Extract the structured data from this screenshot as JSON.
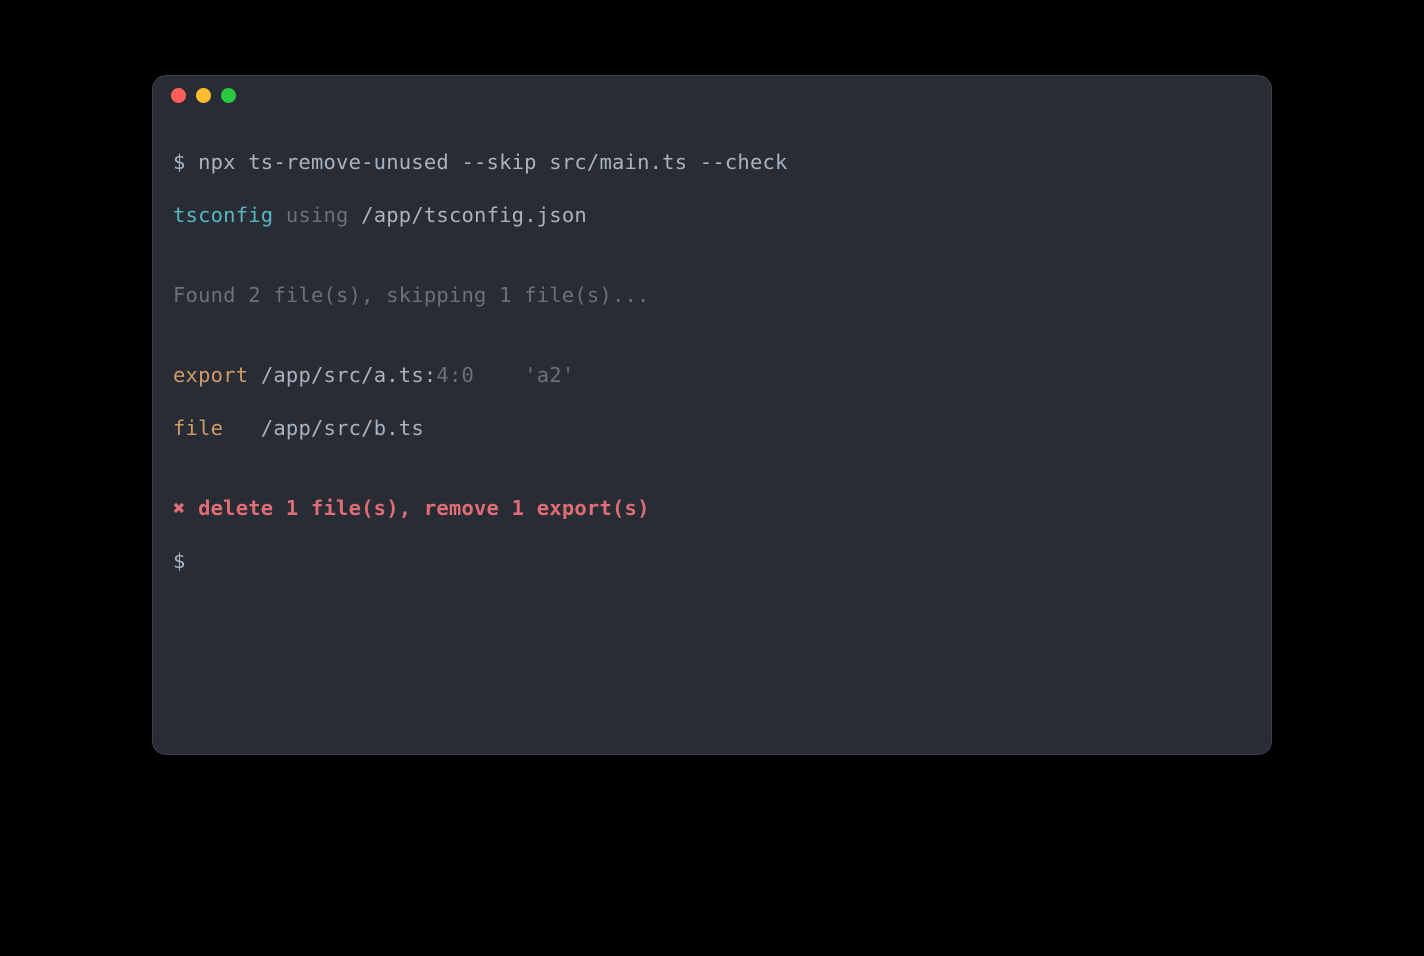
{
  "colors": {
    "close": "#ff5f57",
    "minimize": "#febc2e",
    "maximize": "#28c840",
    "bg": "#282c34",
    "fg": "#abb2bf",
    "dim": "#6b7179",
    "blue": "#56b6c2",
    "yellow": "#d19a66",
    "red": "#e06c75"
  },
  "prompt": "$",
  "command": "npx ts-remove-unused --skip src/main.ts --check",
  "tsconfig": {
    "label": "tsconfig",
    "verb": "using",
    "path": "/app/tsconfig.json"
  },
  "found": "Found 2 file(s), skipping 1 file(s)...",
  "results": [
    {
      "kind": "export",
      "path": "/app/src/a.ts:",
      "loc": "4:0",
      "name": "'a2'"
    },
    {
      "kind": "file",
      "path": "/app/src/b.ts",
      "loc": "",
      "name": ""
    }
  ],
  "summary": {
    "symbol": "✖",
    "text": "delete 1 file(s), remove 1 export(s)"
  },
  "trailing_prompt": "$"
}
